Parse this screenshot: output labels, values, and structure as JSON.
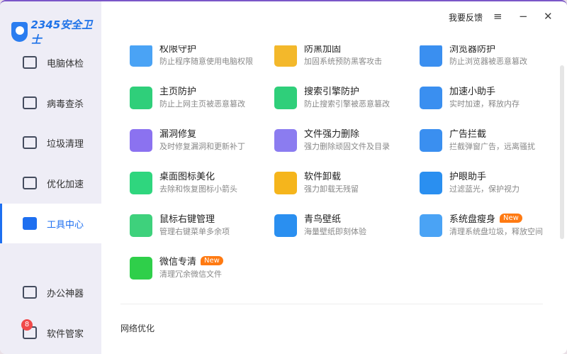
{
  "app": {
    "logo_text": "2345安全卫士"
  },
  "header": {
    "feedback": "我要反馈",
    "menu_icon": "≡",
    "minimize": "−",
    "close": "✕"
  },
  "sidebar": {
    "items": [
      {
        "label": "电脑体检",
        "icon": "monitor-icon"
      },
      {
        "label": "病毒查杀",
        "icon": "target-icon"
      },
      {
        "label": "垃圾清理",
        "icon": "trash-icon"
      },
      {
        "label": "优化加速",
        "icon": "rocket-icon"
      },
      {
        "label": "工具中心",
        "icon": "toolbox-icon",
        "active": true
      },
      {
        "label": "办公神器",
        "icon": "checklist-icon"
      },
      {
        "label": "软件管家",
        "icon": "box-icon",
        "badge": "8"
      }
    ]
  },
  "tools": [
    {
      "title": "权限守护",
      "desc": "防止程序随意使用电脑权限",
      "color": "#4aa3f5"
    },
    {
      "title": "防黑加固",
      "desc": "加固系统预防黑客攻击",
      "color": "#f3b82b"
    },
    {
      "title": "浏览器防护",
      "desc": "防止浏览器被恶意篡改",
      "color": "#3a8ff0"
    },
    {
      "title": "主页防护",
      "desc": "防止上网主页被恶意篡改",
      "color": "#2fcf7a"
    },
    {
      "title": "搜索引擎防护",
      "desc": "防止搜索引擎被恶意篡改",
      "color": "#2fcf7a"
    },
    {
      "title": "加速小助手",
      "desc": "实时加速，释放内存",
      "color": "#3a8ff0"
    },
    {
      "title": "漏洞修复",
      "desc": "及时修复漏洞和更新补丁",
      "color": "#8b72f0"
    },
    {
      "title": "文件强力删除",
      "desc": "强力删除顽固文件及目录",
      "color": "#8b7cf0"
    },
    {
      "title": "广告拦截",
      "desc": "拦截弹窗广告，远离骚扰",
      "color": "#3a8ff0"
    },
    {
      "title": "桌面图标美化",
      "desc": "去除和恢复图标小箭头",
      "color": "#2fd67e"
    },
    {
      "title": "软件卸载",
      "desc": "强力卸载无残留",
      "color": "#f5b51c"
    },
    {
      "title": "护眼助手",
      "desc": "过滤蓝光，保护视力",
      "color": "#2a8ff0"
    },
    {
      "title": "鼠标右键管理",
      "desc": "管理右键菜单多余项",
      "color": "#3ed17c"
    },
    {
      "title": "青鸟壁纸",
      "desc": "海量壁纸即刻体验",
      "color": "#2a8ff0"
    },
    {
      "title": "系统盘瘦身",
      "desc": "清理系统盘垃圾，释放空间",
      "color": "#4aa3f5",
      "badge": "New"
    },
    {
      "title": "微信专清",
      "desc": "清理冗余微信文件",
      "color": "#2fcf4a",
      "badge": "New"
    }
  ],
  "section_next": "网络优化"
}
